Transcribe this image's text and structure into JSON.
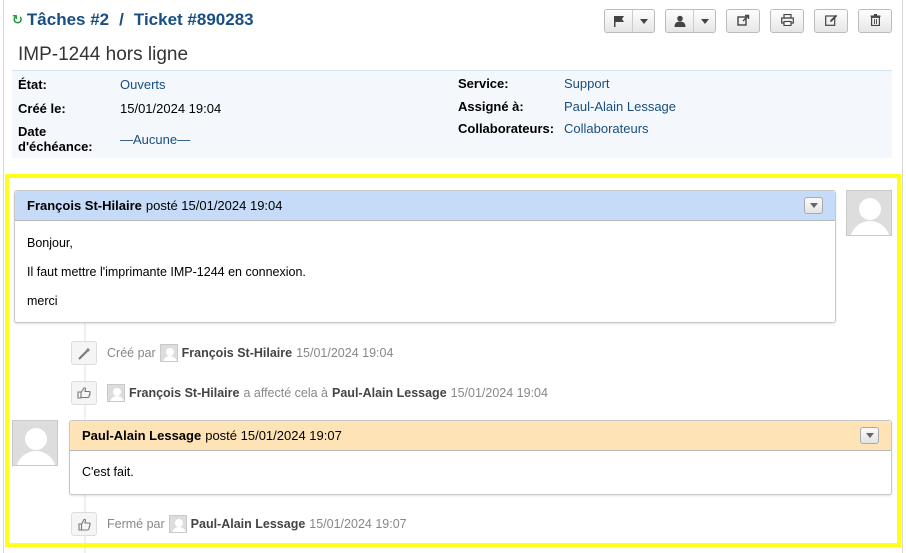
{
  "header": {
    "tasks_link": "Tâches #2",
    "separator": "/",
    "ticket_link": "Ticket #890283",
    "subject": "IMP-1244 hors ligne"
  },
  "toolbar": {
    "icons": [
      "flag-icon",
      "user-icon",
      "share-icon",
      "print-icon",
      "edit-icon",
      "trash-icon"
    ]
  },
  "info": {
    "etat_label": "État:",
    "etat_value": "Ouverts",
    "cree_label": "Créé le:",
    "cree_value": "15/01/2024 19:04",
    "echeance_label_1": "Date",
    "echeance_label_2": "d'échéance:",
    "echeance_value": "—Aucune—",
    "service_label": "Service:",
    "service_value": "Support",
    "assigne_label": "Assigné à:",
    "assigne_value": "Paul-Alain Lessage",
    "collab_label": "Collaborateurs:",
    "collab_value": "Collaborateurs"
  },
  "thread": {
    "message1": {
      "author": "François St-Hilaire",
      "meta": "posté 15/01/2024 19:04",
      "lines": [
        "Bonjour,",
        "Il faut mettre l'imprimante IMP-1244 en connexion.",
        "merci"
      ]
    },
    "event1": {
      "prefix": "Créé par",
      "user": "François St-Hilaire",
      "time": "15/01/2024 19:04"
    },
    "event2": {
      "user": "François St-Hilaire",
      "middle": "a affecté cela à",
      "target": "Paul-Alain Lessage",
      "time": "15/01/2024 19:04"
    },
    "message2": {
      "author": "Paul-Alain Lessage",
      "meta": "posté 15/01/2024 19:07",
      "lines": [
        "C'est fait."
      ]
    },
    "event3": {
      "prefix": "Fermé par",
      "user": "Paul-Alain Lessage",
      "time": "15/01/2024 19:07"
    }
  },
  "colors": {
    "link": "#184e81",
    "message1_header": "#c6dbf7",
    "message2_header": "#fde3b5",
    "highlight": "#ffff1a",
    "info_bg": "#f4f8fc"
  }
}
